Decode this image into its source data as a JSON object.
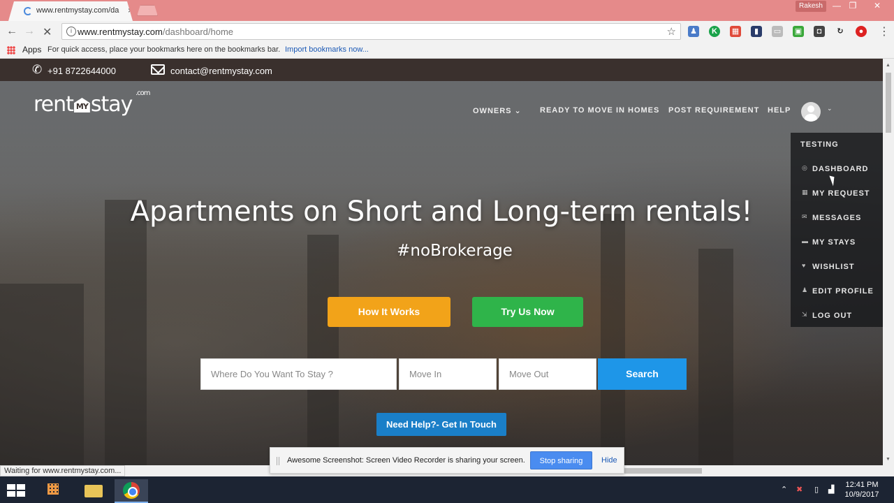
{
  "browser": {
    "tab_title": "www.rentmystay.com/da",
    "tab_close": "×",
    "profile_name": "Rakesh",
    "url_host": "www.rentmystay.com",
    "url_path": "/dashboard/home",
    "bookmarks": {
      "apps_label": "Apps",
      "hint": "For quick access, place your bookmarks here on the bookmarks bar.",
      "import_link": "Import bookmarks now..."
    },
    "status_text": "Waiting for www.rentmystay.com..."
  },
  "contact": {
    "phone": "+91 8722644000",
    "email": "contact@rentmystay.com"
  },
  "logo": {
    "part1": "rent",
    "part2": "MY",
    "part3": "stay",
    "suffix": ".com"
  },
  "nav": {
    "owners": "OWNERS",
    "ready": "READY TO MOVE IN HOMES",
    "post": "POST REQUIREMENT",
    "help": "HELP"
  },
  "user_menu": {
    "items": [
      {
        "label": "TESTING",
        "icon": ""
      },
      {
        "label": "DASHBOARD",
        "icon": "◎"
      },
      {
        "label": "MY REQUEST",
        "icon": "▦"
      },
      {
        "label": "MESSAGES",
        "icon": "✉"
      },
      {
        "label": "MY STAYS",
        "icon": "▬"
      },
      {
        "label": "WISHLIST",
        "icon": "♥"
      },
      {
        "label": "EDIT PROFILE",
        "icon": "♟"
      },
      {
        "label": "LOG OUT",
        "icon": "⇲"
      }
    ]
  },
  "hero": {
    "title": "Apartments on Short and Long-term rentals!",
    "subtitle": "#noBrokerage",
    "how_button": "How It Works",
    "try_button": "Try Us Now"
  },
  "search": {
    "where_placeholder": "Where Do You Want To Stay ?",
    "move_in_placeholder": "Move In",
    "move_out_placeholder": "Move Out",
    "button": "Search"
  },
  "help_button": "Need Help?- Get In Touch",
  "share_bar": {
    "text": "Awesome Screenshot: Screen Video Recorder is sharing your screen.",
    "stop": "Stop sharing",
    "hide": "Hide"
  },
  "taskbar": {
    "time": "12:41 PM",
    "date": "10/9/2017"
  }
}
